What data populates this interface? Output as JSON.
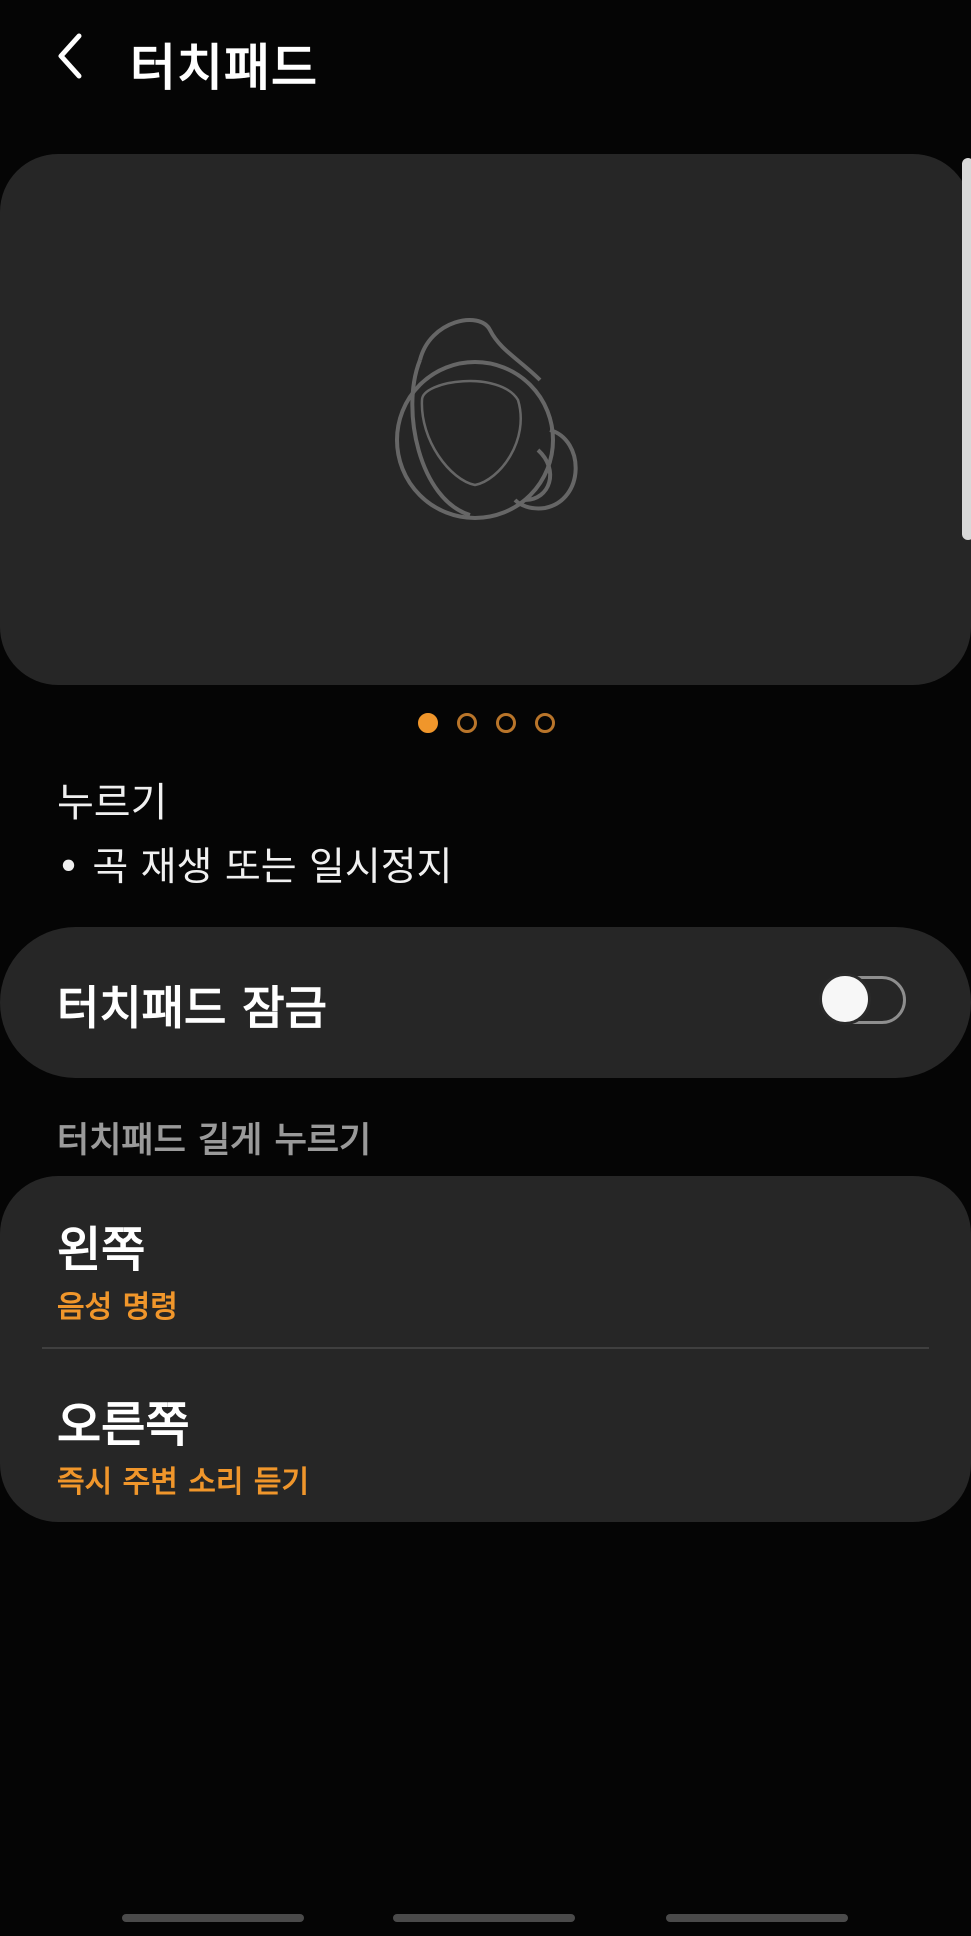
{
  "header": {
    "back_icon": "chevron-left-icon",
    "title": "터치패드"
  },
  "carousel": {
    "image_icon": "earbud-icon",
    "page_count": 4,
    "active_page": 1,
    "accent_color": "#f0962b"
  },
  "description": {
    "title": "누르기",
    "bullet": "• 곡 재생 또는 일시정지"
  },
  "lock": {
    "label": "터치패드 잠금",
    "enabled": false
  },
  "long_press": {
    "section_title": "터치패드 길게 누르기",
    "left_title": "왼쪽",
    "left_value": "음성 명령",
    "right_title": "오른쪽",
    "right_value": "즉시 주변 소리 듣기"
  }
}
